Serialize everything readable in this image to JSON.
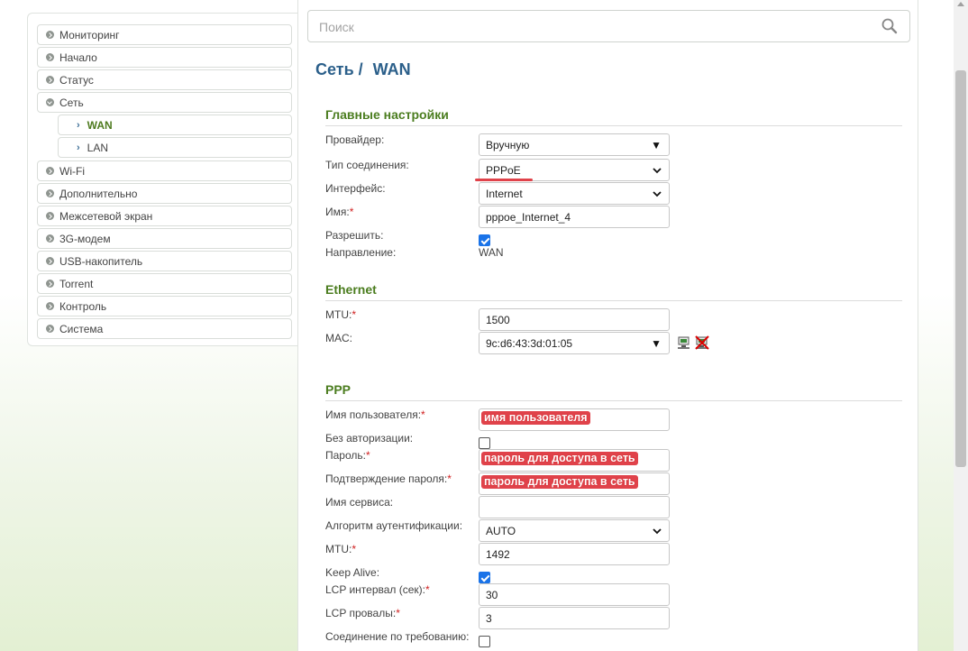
{
  "sidebar": {
    "items": [
      {
        "label": "Мониторинг"
      },
      {
        "label": "Начало"
      },
      {
        "label": "Статус"
      },
      {
        "label": "Сеть"
      },
      {
        "label": "WAN"
      },
      {
        "label": "LAN"
      },
      {
        "label": "Wi-Fi"
      },
      {
        "label": "Дополнительно"
      },
      {
        "label": "Межсетевой экран"
      },
      {
        "label": "3G-модем"
      },
      {
        "label": "USB-накопитель"
      },
      {
        "label": "Torrent"
      },
      {
        "label": "Контроль"
      },
      {
        "label": "Система"
      }
    ]
  },
  "search": {
    "placeholder": "Поиск"
  },
  "breadcrumb": {
    "parent": "Сеть /",
    "current": "WAN"
  },
  "main_settings": {
    "title": "Главные настройки",
    "provider_label": "Провайдер:",
    "provider_value": "Вручную",
    "conn_type_label": "Тип соединения:",
    "conn_type_value": "PPPoE",
    "interface_label": "Интерфейс:",
    "interface_value": "Internet",
    "name_label": "Имя:",
    "name_value": "pppoe_Internet_4",
    "enable_label": "Разрешить:",
    "direction_label": "Направление:",
    "direction_value": "WAN"
  },
  "ethernet": {
    "title": "Ethernet",
    "mtu_label": "MTU:",
    "mtu_value": "1500",
    "mac_label": "MAC:",
    "mac_value": "9c:d6:43:3d:01:05"
  },
  "ppp": {
    "title": "PPP",
    "username_label": "Имя пользователя:",
    "username_overlay": "имя пользователя",
    "no_auth_label": "Без авторизации:",
    "password_label": "Пароль:",
    "password_overlay": "пароль для доступа в сеть",
    "confirm_label": "Подтверждение пароля:",
    "confirm_overlay": "пароль для доступа в сеть",
    "service_label": "Имя сервиса:",
    "auth_algo_label": "Алгоритм аутентификации:",
    "auth_algo_value": "AUTO",
    "mtu_label": "MTU:",
    "mtu_value": "1492",
    "keepalive_label": "Keep Alive:",
    "lcp_interval_label": "LCP интервал (сек):",
    "lcp_interval_value": "30",
    "lcp_fails_label": "LCP провалы:",
    "lcp_fails_value": "3",
    "on_demand_label": "Соединение по требованию:"
  },
  "required_mark": "*",
  "colors": {
    "accent_blue": "#2b5f8a",
    "section_green": "#4b7d1f",
    "annotation_red": "#e0424a",
    "checkbox_blue": "#1a73e8"
  }
}
